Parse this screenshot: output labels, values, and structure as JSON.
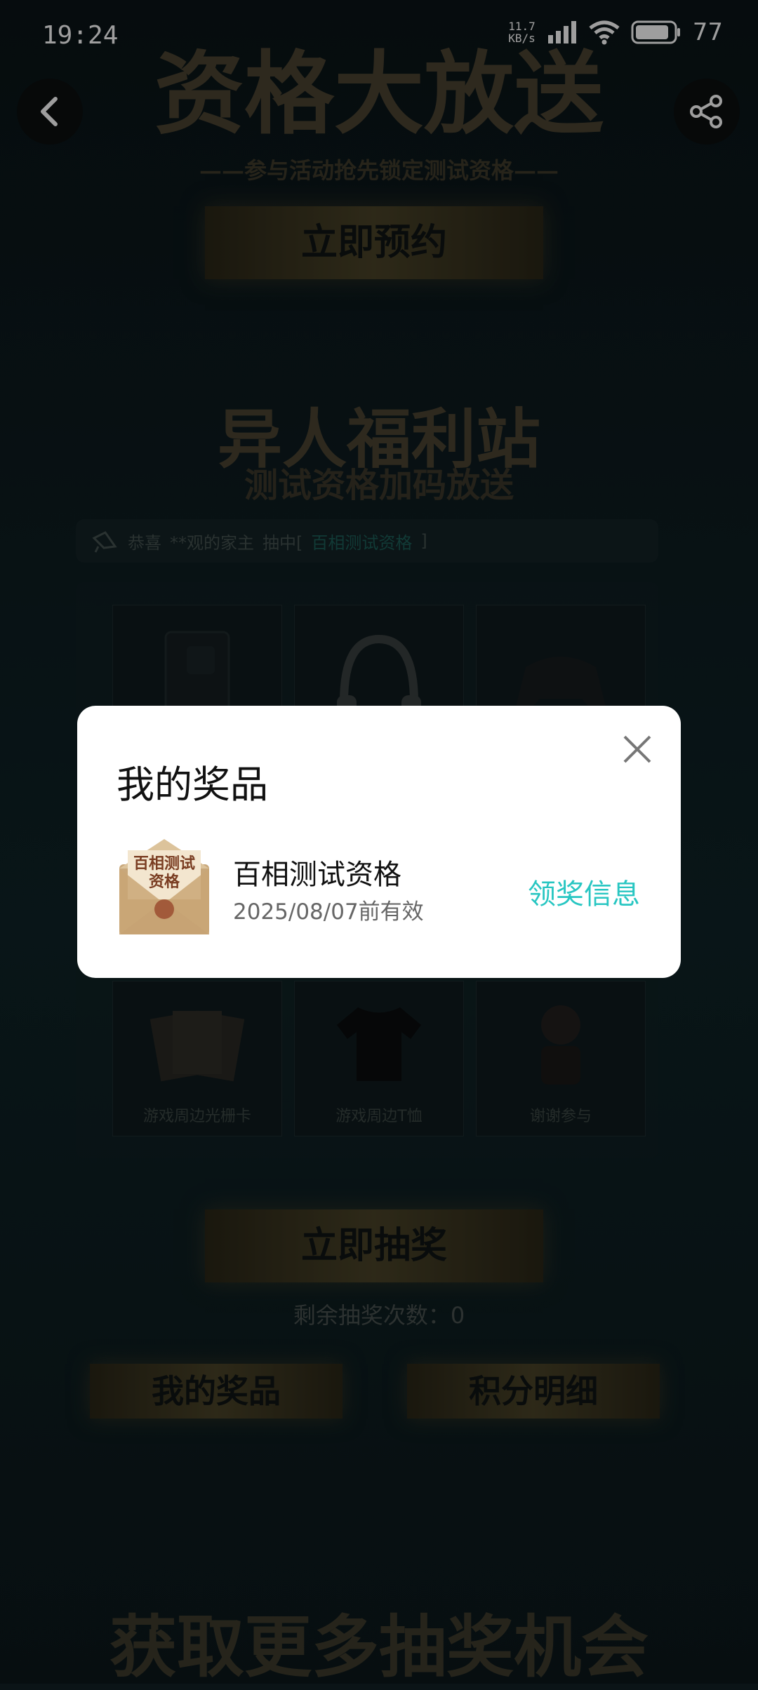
{
  "status_bar": {
    "time": "19:24",
    "net_speed_value": "11.7",
    "net_speed_unit": "KB/s",
    "battery": "77"
  },
  "page": {
    "hero_title": "资格大放送",
    "hero_subtitle": "参与活动抢先锁定测试资格",
    "reserve_button": "立即预约",
    "welfare_title": "异人福利站",
    "welfare_subtitle": "测试资格加码放送",
    "ticker": {
      "prefix": "恭喜",
      "user": "**观的家主",
      "middle": "抽中[",
      "prize": "百相测试资格",
      "suffix": "]"
    },
    "tiles_bottom": [
      "游戏周边光栅卡",
      "游戏周边T恤",
      "谢谢参与"
    ],
    "draw_button": "立即抽奖",
    "remaining_label": "剩余抽奖次数：",
    "remaining_count": "0",
    "my_prizes_button": "我的奖品",
    "points_button": "积分明细",
    "more_chances": "获取更多抽奖机会"
  },
  "modal": {
    "title": "我的奖品",
    "prize_name": "百相测试资格",
    "prize_expiry": "2025/08/07前有效",
    "claim_link": "领奖信息",
    "envelope_text_1": "百相测试",
    "envelope_text_2": "资格"
  },
  "icons": {
    "back": "chevron-left-icon",
    "share": "share-icon",
    "close": "close-icon"
  },
  "colors": {
    "accent": "#28c6c2",
    "gold": "#4b4331"
  }
}
